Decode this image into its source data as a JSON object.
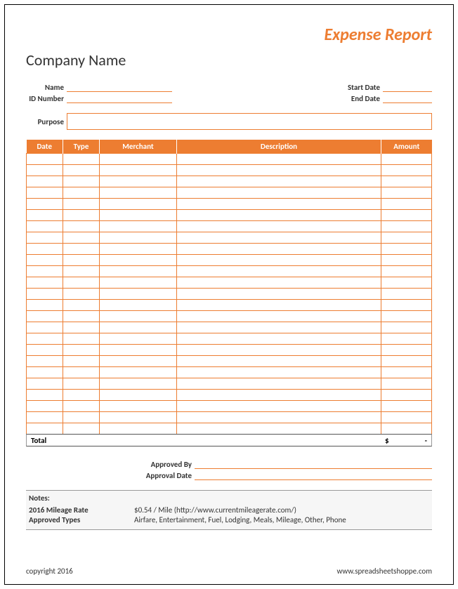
{
  "title": "Expense Report",
  "company": "Company Name",
  "labels": {
    "name": "Name",
    "id": "ID Number",
    "start": "Start Date",
    "end": "End Date",
    "purpose": "Purpose",
    "total": "Total",
    "approved_by": "Approved By",
    "approval_date": "Approval Date"
  },
  "columns": {
    "date": "Date",
    "type": "Type",
    "merchant": "Merchant",
    "description": "Description",
    "amount": "Amount"
  },
  "total_currency": "$",
  "total_value": "-",
  "row_count": 25,
  "notes": {
    "heading": "Notes:",
    "mileage_label": "2016 Mileage Rate",
    "mileage_value": "$0.54 / Mile (http://www.currentmileagerate.com/)",
    "types_label": "Approved Types",
    "types_value": "Airfare, Entertainment, Fuel, Lodging, Meals, Mileage, Other, Phone"
  },
  "footer": {
    "copyright": "copyright 2016",
    "site": "www.spreadsheetshoppe.com"
  }
}
